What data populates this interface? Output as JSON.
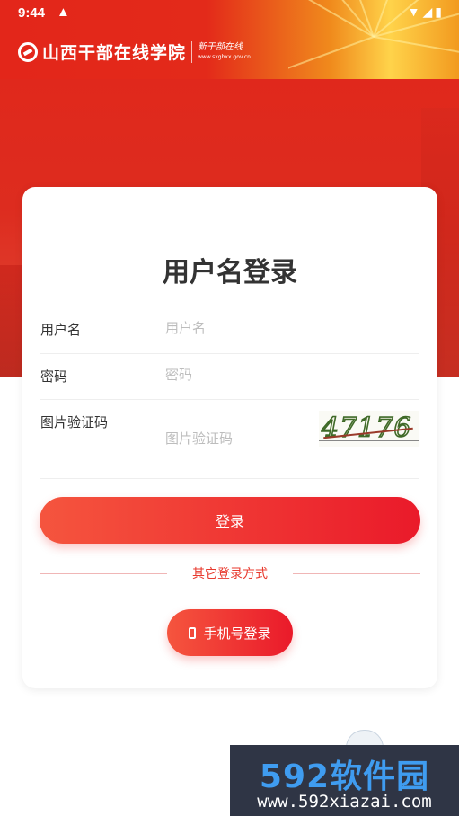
{
  "status_bar": {
    "time": "9:44",
    "warning_icon": "warning-triangle-icon",
    "right_icons": "▼◢▮"
  },
  "header": {
    "site_name": "山西干部在线学院",
    "slogan": "新干部在线",
    "url": "www.sxgbxx.gov.cn"
  },
  "login": {
    "title": "用户名登录",
    "username_label": "用户名",
    "username_placeholder": "用户名",
    "password_label": "密码",
    "password_placeholder": "密码",
    "captcha_label": "图片验证码",
    "captcha_placeholder": "图片验证码",
    "captcha_code": "47176",
    "submit_label": "登录",
    "other_methods": "其它登录方式",
    "phone_login_label": "手机号登录"
  },
  "watermark": {
    "brand": "592软件园",
    "url": "www.592xiazai.com"
  },
  "colors": {
    "primary": "#e8262a",
    "gradient_start": "#f5553e",
    "header_red": "#e2261a",
    "accent_gold": "#ffd34a"
  }
}
